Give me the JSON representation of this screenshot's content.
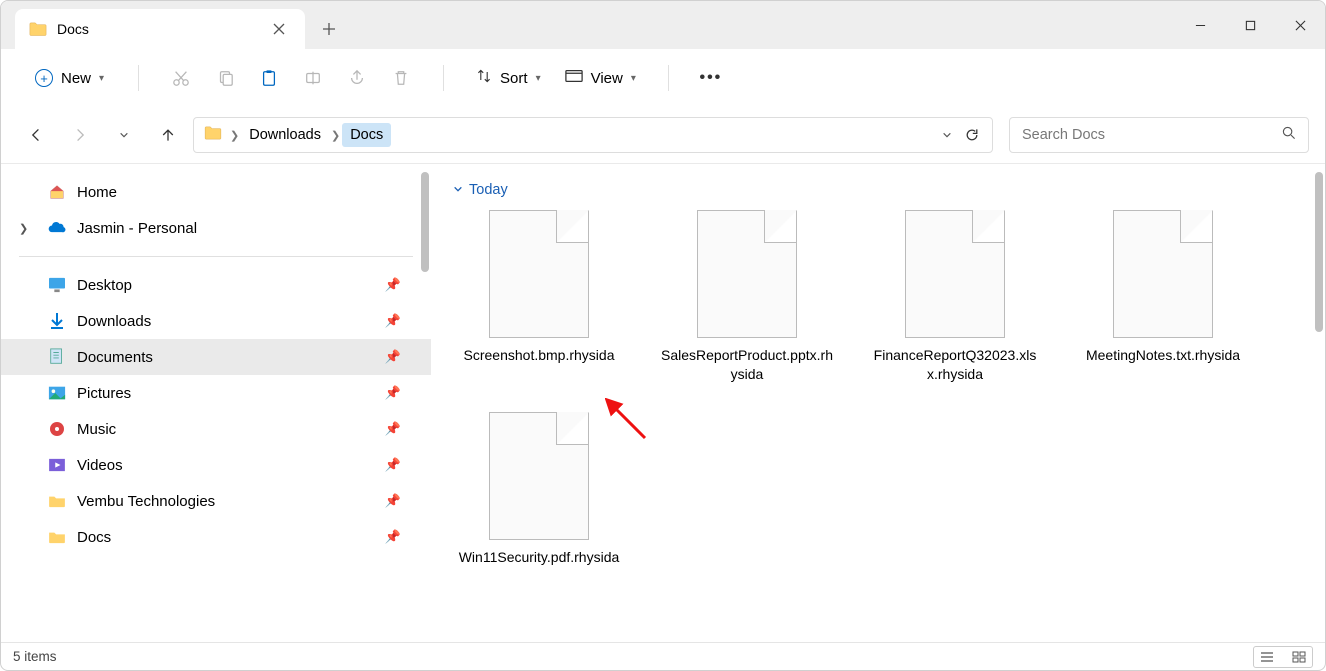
{
  "tab": {
    "title": "Docs"
  },
  "toolbar": {
    "new_label": "New",
    "sort_label": "Sort",
    "view_label": "View"
  },
  "breadcrumb": {
    "items": [
      "Downloads",
      "Docs"
    ],
    "active_index": 1
  },
  "search": {
    "placeholder": "Search Docs"
  },
  "sidebar": {
    "home": "Home",
    "cloud": "Jasmin - Personal",
    "pinned": [
      {
        "label": "Desktop",
        "icon": "desktop"
      },
      {
        "label": "Downloads",
        "icon": "downloads"
      },
      {
        "label": "Documents",
        "icon": "documents",
        "selected": true
      },
      {
        "label": "Pictures",
        "icon": "pictures"
      },
      {
        "label": "Music",
        "icon": "music"
      },
      {
        "label": "Videos",
        "icon": "videos"
      },
      {
        "label": "Vembu Technologies",
        "icon": "folder"
      },
      {
        "label": "Docs",
        "icon": "folder"
      }
    ]
  },
  "content": {
    "group": "Today",
    "files": [
      {
        "name": "Screenshot.bmp.rhysida"
      },
      {
        "name": "SalesReportProduct.pptx.rhysida"
      },
      {
        "name": "FinanceReportQ32023.xlsx.rhysida"
      },
      {
        "name": "MeetingNotes.txt.rhysida"
      },
      {
        "name": "Win11Security.pdf.rhysida"
      }
    ]
  },
  "status": {
    "count_text": "5 items"
  }
}
